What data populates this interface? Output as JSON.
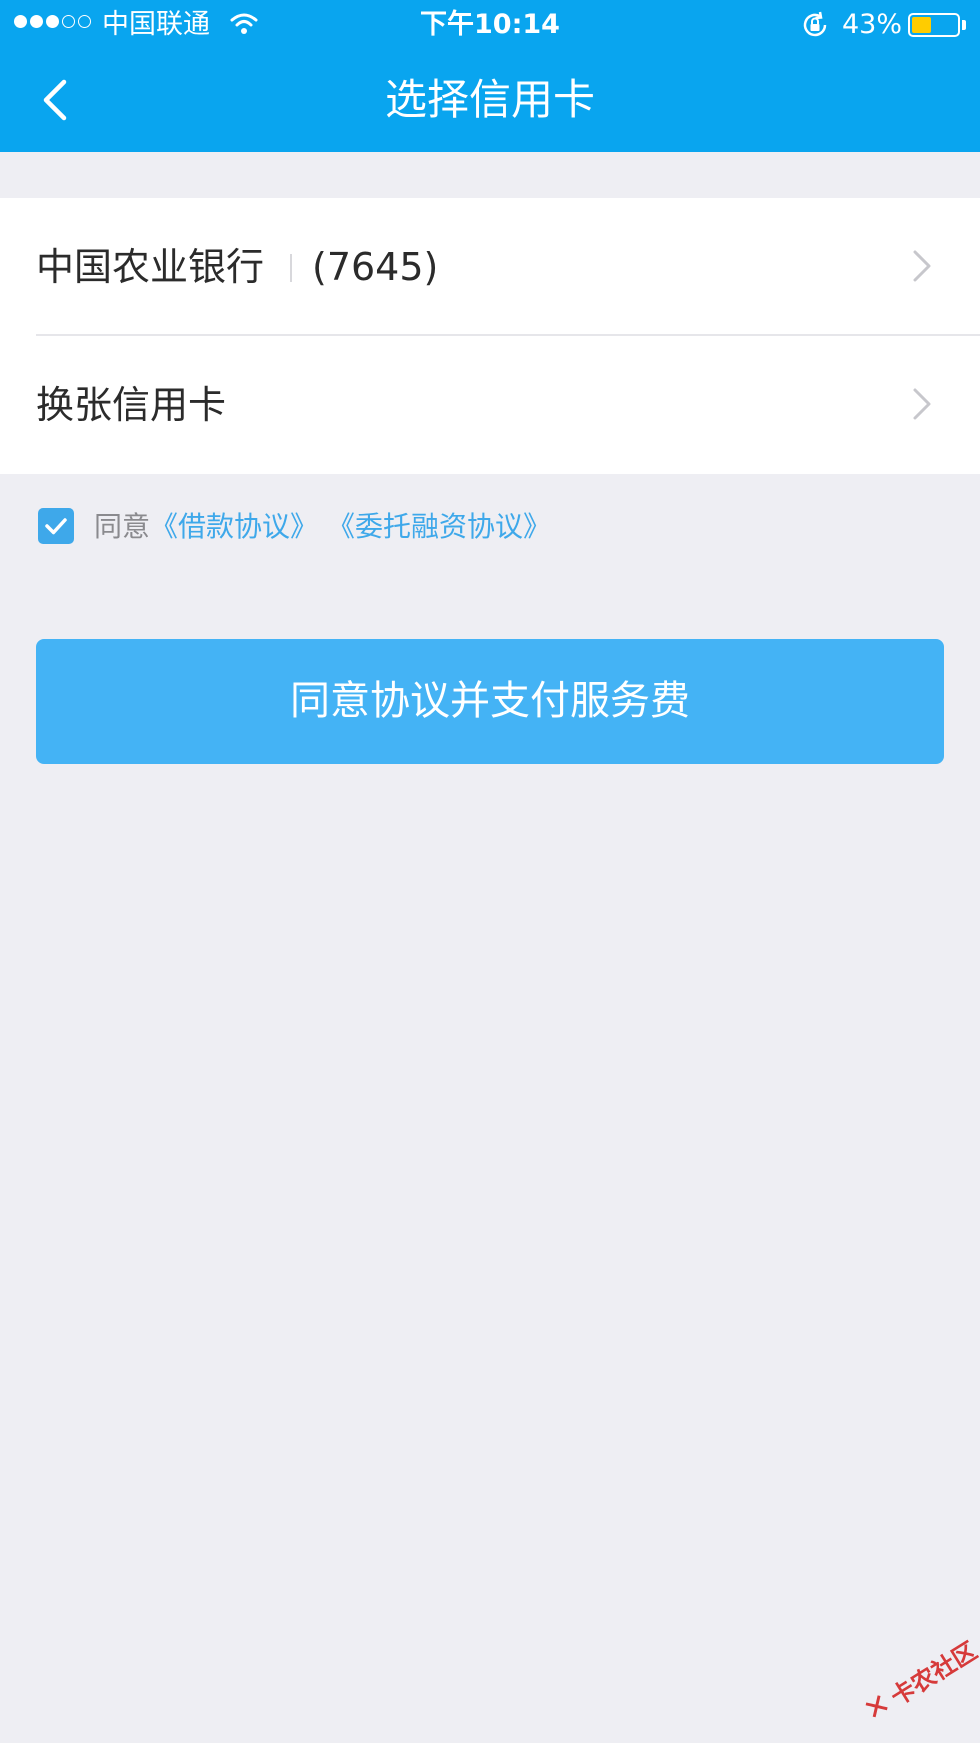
{
  "status_bar": {
    "signal_bars_filled": 3,
    "signal_bars_total": 5,
    "carrier": "中国联通",
    "time": "下午10:14",
    "battery_percent": "43%",
    "battery_level": 0.43,
    "battery_color": "#ffcc00"
  },
  "nav": {
    "title": "选择信用卡",
    "back_icon": "chevron-left-icon"
  },
  "cards": {
    "selected": {
      "bank_name": "中国农业银行",
      "card_number": "(7645)"
    },
    "change_label": "换张信用卡"
  },
  "agreement": {
    "checked": true,
    "prefix": "同意",
    "loan_agreement": "《借款协议》",
    "entrust_agreement": "《委托融资协议》"
  },
  "submit_button": {
    "label": "同意协议并支付服务费"
  },
  "watermark": {
    "text": "卡农社区",
    "icon": "kanong-logo-icon"
  },
  "colors": {
    "header_blue": "#09a5ef",
    "button_blue": "#44b3f5",
    "link_blue": "#3ea8ea",
    "page_background": "#eeeef3"
  }
}
